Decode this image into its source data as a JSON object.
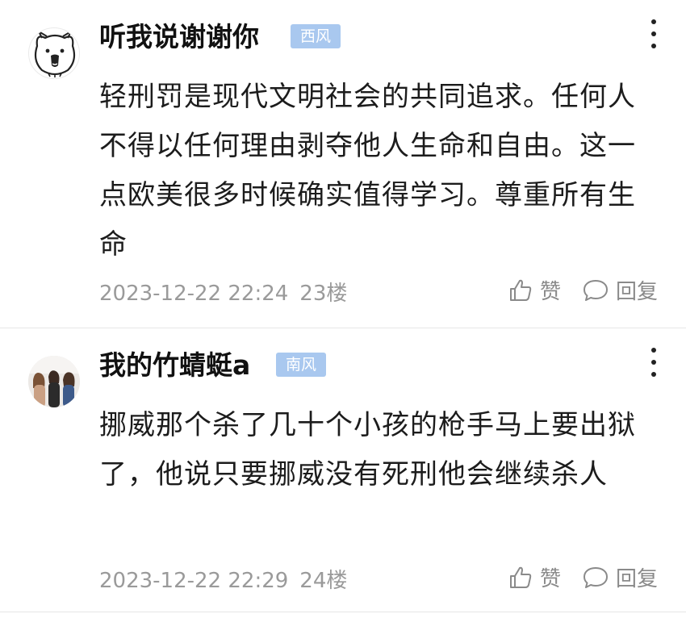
{
  "comments": [
    {
      "username": "听我说谢谢你",
      "badge": "西风",
      "text": "轻刑罚是现代文明社会的共同追求。任何人不得以任何理由剥夺他人生命和自由。这一点欧美很多时候确实值得学习。尊重所有生命",
      "timestamp": "2023-12-22 22:24",
      "floor": "23楼",
      "like_label": "赞",
      "reply_label": "回复",
      "avatar_icon": "cartoon-cat-avatar"
    },
    {
      "username": "我的竹蜻蜓a",
      "badge": "南风",
      "text": "挪威那个杀了几十个小孩的枪手马上要出狱了，他说只要挪威没有死刑他会继续杀人",
      "timestamp": "2023-12-22 22:29",
      "floor": "24楼",
      "like_label": "赞",
      "reply_label": "回复",
      "avatar_icon": "photo-avatar"
    }
  ],
  "colors": {
    "badge_bg": "#a9c8ef",
    "meta_text": "#9a9a9a",
    "divider": "#e6e6e6"
  }
}
